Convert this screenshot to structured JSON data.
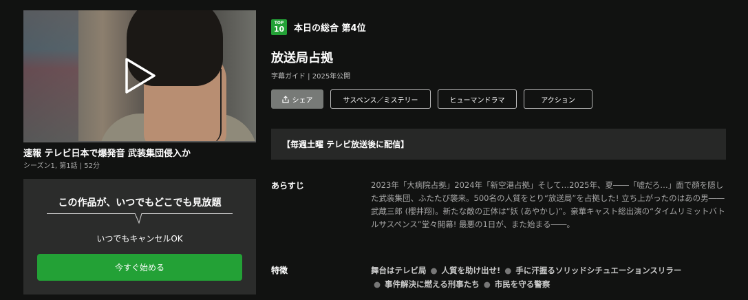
{
  "episode": {
    "title": "速報 テレビ日本で爆発音 武装集団侵入か",
    "meta": "シーズン1, 第1話 | 52分"
  },
  "promo": {
    "headline": "この作品が、いつでもどこでも見放題",
    "sub": "いつでもキャンセルOK",
    "cta": "今すぐ始める"
  },
  "rank": {
    "badge_top": "TOP",
    "badge_num": "10",
    "text": "本日の総合 第4位"
  },
  "show": {
    "title": "放送局占拠",
    "meta": "字幕ガイド | 2025年公開"
  },
  "buttons": {
    "share": "シェア",
    "genre1": "サスペンス／ミステリー",
    "genre2": "ヒューマンドラマ",
    "genre3": "アクション"
  },
  "notice": "【毎週土曜 テレビ放送後に配信】",
  "synopsis": {
    "label": "あらすじ",
    "text": "2023年「大病院占拠」2024年「新空港占拠」そして…2025年、夏――「嘘だろ…」面で顔を隠した武装集団、ふたたび襲来。500名の人質をとり“放送局”を占拠した! 立ち上がったのはあの男――武蔵三郎 (櫻井翔)。新たな敵の正体は“妖 (あやかし)”。豪華キャスト総出演の“タイムリミットバトルサスペンス”堂々開幕! 最悪の1日が、また始まる――。"
  },
  "features": {
    "label": "特徴",
    "items": [
      "舞台はテレビ局",
      "人質を助け出せ!",
      "手に汗握るソリッドシチュエーションスリラー",
      "事件解決に燃える刑事たち",
      "市民を守る警察"
    ]
  },
  "colors": {
    "accent": "#23a136",
    "background": "#111211"
  }
}
